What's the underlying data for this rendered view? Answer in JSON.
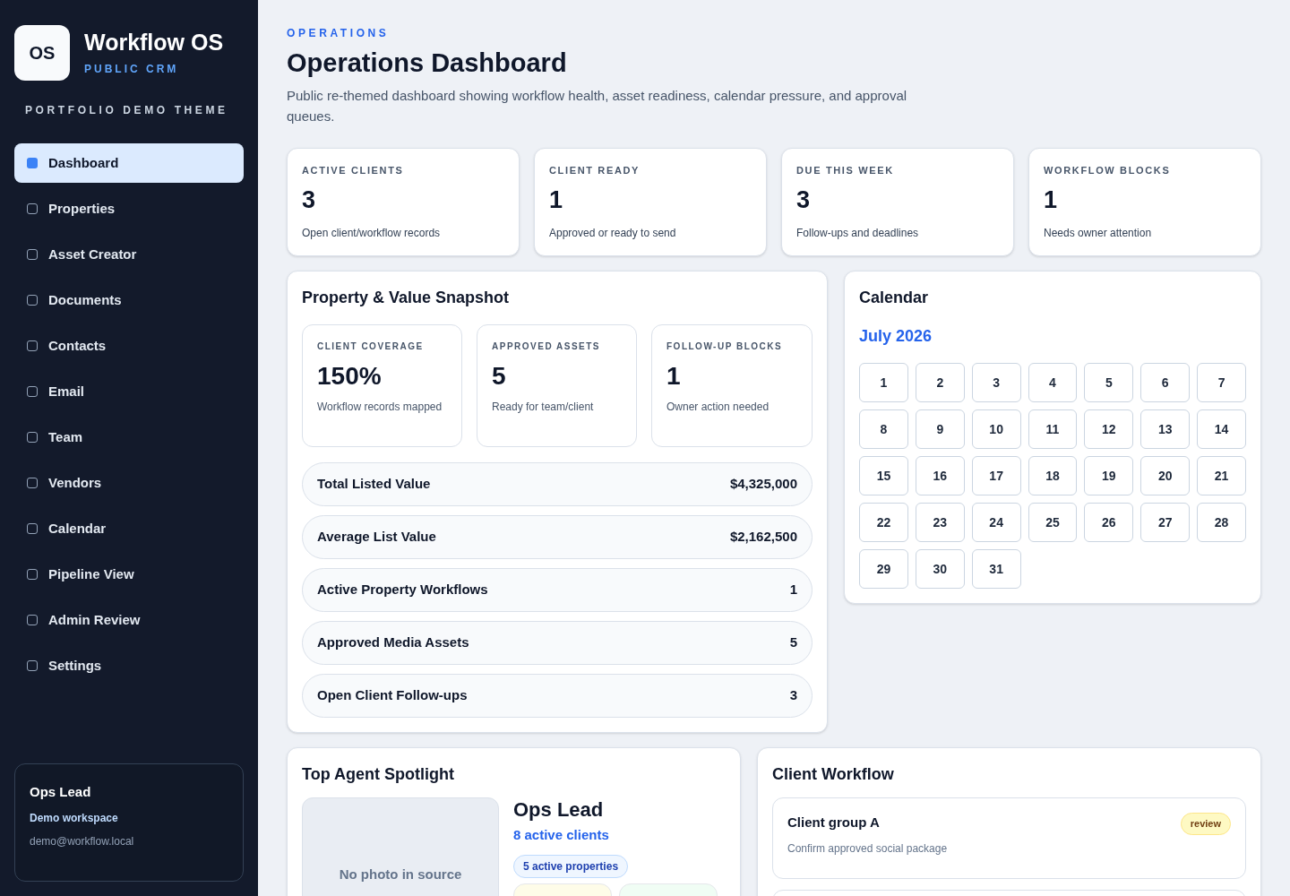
{
  "brand": {
    "logo": "OS",
    "name": "Workflow OS",
    "tagline": "PUBLIC CRM",
    "theme": "PORTFOLIO DEMO THEME"
  },
  "sidebar": {
    "items": [
      {
        "label": "Dashboard",
        "selected": true
      },
      {
        "label": "Properties",
        "selected": false
      },
      {
        "label": "Asset Creator",
        "selected": false
      },
      {
        "label": "Documents",
        "selected": false
      },
      {
        "label": "Contacts",
        "selected": false
      },
      {
        "label": "Email",
        "selected": false
      },
      {
        "label": "Team",
        "selected": false
      },
      {
        "label": "Vendors",
        "selected": false
      },
      {
        "label": "Calendar",
        "selected": false
      },
      {
        "label": "Pipeline View",
        "selected": false
      },
      {
        "label": "Admin Review",
        "selected": false
      },
      {
        "label": "Settings",
        "selected": false
      }
    ]
  },
  "user": {
    "name": "Ops Lead",
    "workspace": "Demo workspace",
    "email": "demo@workflow.local"
  },
  "header": {
    "eyebrow": "OPERATIONS",
    "title": "Operations Dashboard",
    "description": "Public re-themed dashboard showing workflow health, asset readiness, calendar pressure, and approval queues."
  },
  "stats": [
    {
      "label": "ACTIVE CLIENTS",
      "value": "3",
      "note": "Open client/workflow records"
    },
    {
      "label": "CLIENT READY",
      "value": "1",
      "note": "Approved or ready to send"
    },
    {
      "label": "DUE THIS WEEK",
      "value": "3",
      "note": "Follow-ups and deadlines"
    },
    {
      "label": "WORKFLOW BLOCKS",
      "value": "1",
      "note": "Needs owner attention"
    }
  ],
  "snapshot": {
    "title": "Property & Value Snapshot",
    "metrics": [
      {
        "label": "CLIENT COVERAGE",
        "value": "150%",
        "note": "Workflow records mapped"
      },
      {
        "label": "APPROVED ASSETS",
        "value": "5",
        "note": "Ready for team/client"
      },
      {
        "label": "FOLLOW-UP BLOCKS",
        "value": "1",
        "note": "Owner action needed"
      }
    ],
    "rows": [
      {
        "label": "Total Listed Value",
        "value": "$4,325,000"
      },
      {
        "label": "Average List Value",
        "value": "$2,162,500"
      },
      {
        "label": "Active Property Workflows",
        "value": "1"
      },
      {
        "label": "Approved Media Assets",
        "value": "5"
      },
      {
        "label": "Open Client Follow-ups",
        "value": "3"
      }
    ]
  },
  "calendar": {
    "title": "Calendar",
    "month": "July 2026",
    "days": [
      "1",
      "2",
      "3",
      "4",
      "5",
      "6",
      "7",
      "8",
      "9",
      "10",
      "11",
      "12",
      "13",
      "14",
      "15",
      "16",
      "17",
      "18",
      "19",
      "20",
      "21",
      "22",
      "23",
      "24",
      "25",
      "26",
      "27",
      "28",
      "29",
      "30",
      "31"
    ]
  },
  "spotlight": {
    "title": "Top Agent Spotlight",
    "photo_text": "No photo in source",
    "name": "Ops Lead",
    "clients": "8 active clients",
    "tags": [
      {
        "label": "5 active properties",
        "color": "#eff6ff"
      },
      {
        "color": "#fefce8"
      },
      {
        "color": "#f0fdf4"
      }
    ]
  },
  "client_workflow": {
    "title": "Client Workflow",
    "items": [
      {
        "name": "Client group A",
        "task": "Confirm approved social package",
        "status": "review"
      }
    ]
  }
}
